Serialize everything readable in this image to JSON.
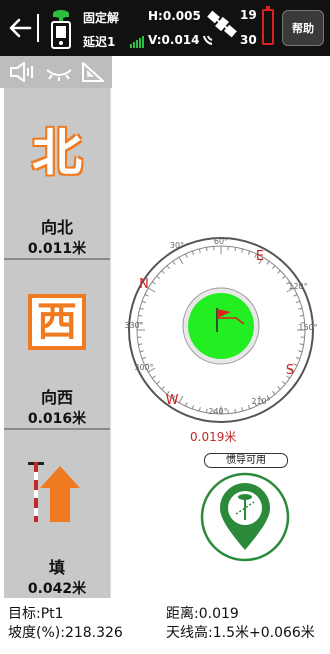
{
  "header": {
    "fix_status": "固定解",
    "delay": "延迟1",
    "h_precision": "H:0.005",
    "v_precision": "V:0.014",
    "sat_used": "19",
    "sat_visible": "30",
    "help_label": "帮助"
  },
  "direction_panels": [
    {
      "glyph": "北",
      "label": "向北",
      "value": "0.011米"
    },
    {
      "glyph": "西",
      "label": "向西",
      "value": "0.016米"
    },
    {
      "glyph": "",
      "label": "填",
      "value": "0.042米"
    }
  ],
  "compass": {
    "degree_labels": [
      "30°",
      "60°",
      "120°",
      "150°",
      "210°",
      "240°",
      "300°",
      "330°"
    ],
    "cardinals": [
      "N",
      "E",
      "S",
      "W"
    ],
    "distance": "0.019米"
  },
  "inertia_label": "惯导可用",
  "footer": {
    "target": "目标:Pt1",
    "distance": "距离:0.019",
    "slope": "坡度(%):218.326",
    "antenna": "天线高:1.5米+0.066米"
  },
  "colors": {
    "accent": "#f07a20",
    "compass_red": "#d02020",
    "target_green": "#22ee22",
    "nav_green": "#2a8a3a"
  }
}
